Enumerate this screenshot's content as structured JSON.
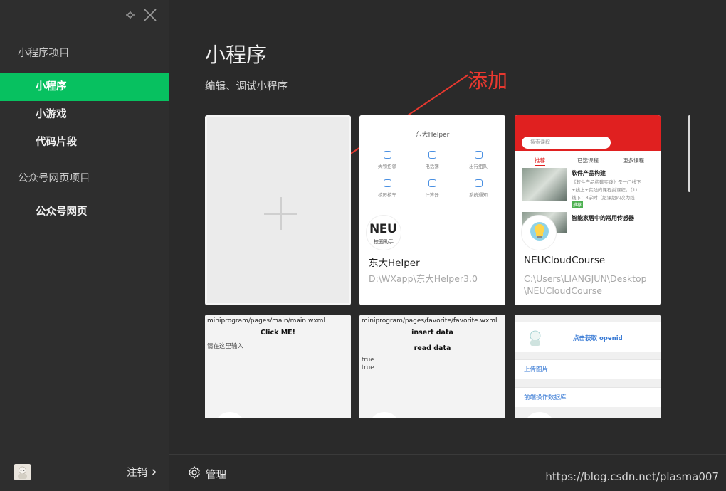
{
  "sidebar": {
    "section_miniapp": "小程序项目",
    "items_miniapp": [
      "小程序",
      "小游戏",
      "代码片段"
    ],
    "section_web": "公众号网页项目",
    "items_web": [
      "公众号网页"
    ],
    "logout": "注销"
  },
  "main": {
    "title": "小程序",
    "subtitle": "编辑、调试小程序",
    "annotation": "添加",
    "manage": "管理",
    "watermark": "https://blog.csdn.net/plasma007"
  },
  "cards": {
    "helper": {
      "name": "东大Helper",
      "path": "D:\\WXapp\\东大Helper3.0",
      "preview_title": "东大Helper",
      "cells": [
        "失物招领",
        "电话簿",
        "出行组队",
        "校历校车",
        "计算器",
        "系统通知"
      ],
      "logo_text": "NEU",
      "logo_sub": "校园助手"
    },
    "neucloud": {
      "name": "NEUCloudCourse",
      "path": "C:\\Users\\LIANGJUN\\Desktop\\NEUCloudCourse",
      "search": "搜索课程",
      "tabs": [
        "推荐",
        "已选课程",
        "更多课程"
      ],
      "item1_title": "软件产品构建",
      "item1_l1": "《软件产品构建实践》是一门线下",
      "item1_l2": "+线上+实践的课程类课程。（1）",
      "item1_l3": "线下：8学时（超课超四次为线",
      "item1_tag": "推荐",
      "item2_title": "智能家居中的常用传感器"
    },
    "main_wxml": {
      "path": "miniprogram/pages/main/main.wxml",
      "button": "Click ME!",
      "hint": "请在这里输入"
    },
    "favorite_wxml": {
      "path": "miniprogram/pages/favorite/favorite.wxml",
      "insert": "insert data",
      "read": "read data",
      "v1": "true",
      "v2": "true"
    },
    "openid": {
      "get": "点击获取 openid",
      "upload": "上传图片",
      "db": "前端操作数据库"
    }
  },
  "colors": {
    "accent": "#07c160",
    "annotation": "#e8382f",
    "sidebar_bg": "#2e2e2e",
    "main_bg": "#2a2a2a"
  }
}
